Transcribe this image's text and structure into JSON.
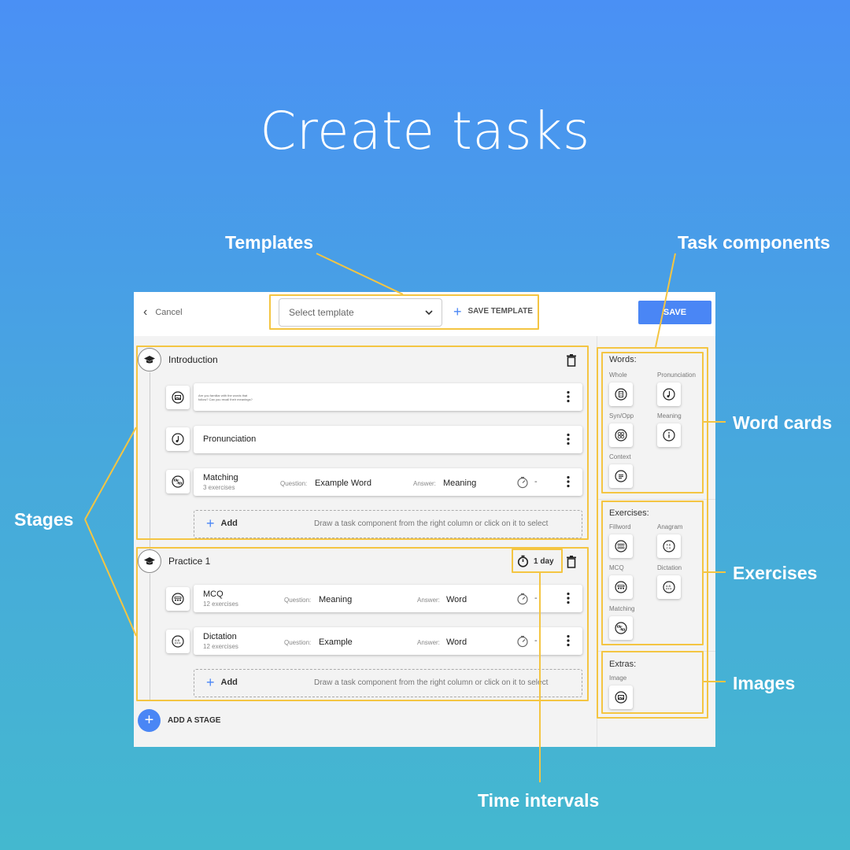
{
  "title": "Create tasks",
  "callouts": {
    "templates": "Templates",
    "task_components": "Task components",
    "word_cards": "Word cards",
    "stages": "Stages",
    "exercises": "Exercises",
    "images": "Images",
    "time_intervals": "Time intervals"
  },
  "colors": {
    "accent": "#4a86f5",
    "highlight": "#f4c542"
  },
  "toolbar": {
    "cancel_label": "Cancel",
    "template_placeholder": "Select template",
    "save_template_label": "SAVE TEMPLATE",
    "save_label": "SAVE"
  },
  "stages": [
    {
      "title": "Introduction",
      "tasks": [
        {
          "icon": "image-icon",
          "text_lines": [
            "Are you familiar with the words that",
            "follow? Can you recall their meanings?"
          ]
        },
        {
          "icon": "note-icon",
          "name": "Pronunciation"
        },
        {
          "icon": "matching-icon",
          "name": "Matching",
          "count": "3 exercises",
          "question_label": "Question:",
          "question": "Example Word",
          "answer_label": "Answer:",
          "answer": "Meaning",
          "interval": "-"
        }
      ],
      "add_label": "Add",
      "add_hint": "Draw a task component from the right column or click on it to select"
    },
    {
      "title": "Practice 1",
      "interval": "1 day",
      "tasks": [
        {
          "icon": "mcq-icon",
          "name": "MCQ",
          "count": "12 exercises",
          "question_label": "Question:",
          "question": "Meaning",
          "answer_label": "Answer:",
          "answer": "Word",
          "interval": "-"
        },
        {
          "icon": "dictation-icon",
          "name": "Dictation",
          "count": "12 exercises",
          "question_label": "Question:",
          "question": "Example",
          "answer_label": "Answer:",
          "answer": "Word",
          "interval": "-"
        }
      ],
      "add_label": "Add",
      "add_hint": "Draw a task component from the right column or click on it to select"
    }
  ],
  "add_stage_label": "ADD A STAGE",
  "sidebar": {
    "words": {
      "heading": "Words:",
      "items": [
        "Whole",
        "Pronunciation",
        "Syn/Opp",
        "Meaning",
        "Context"
      ]
    },
    "exercises": {
      "heading": "Exercises:",
      "items": [
        "Fillword",
        "Anagram",
        "MCQ",
        "Dictation",
        "Matching"
      ]
    },
    "extras": {
      "heading": "Extras:",
      "items": [
        "Image"
      ]
    }
  }
}
